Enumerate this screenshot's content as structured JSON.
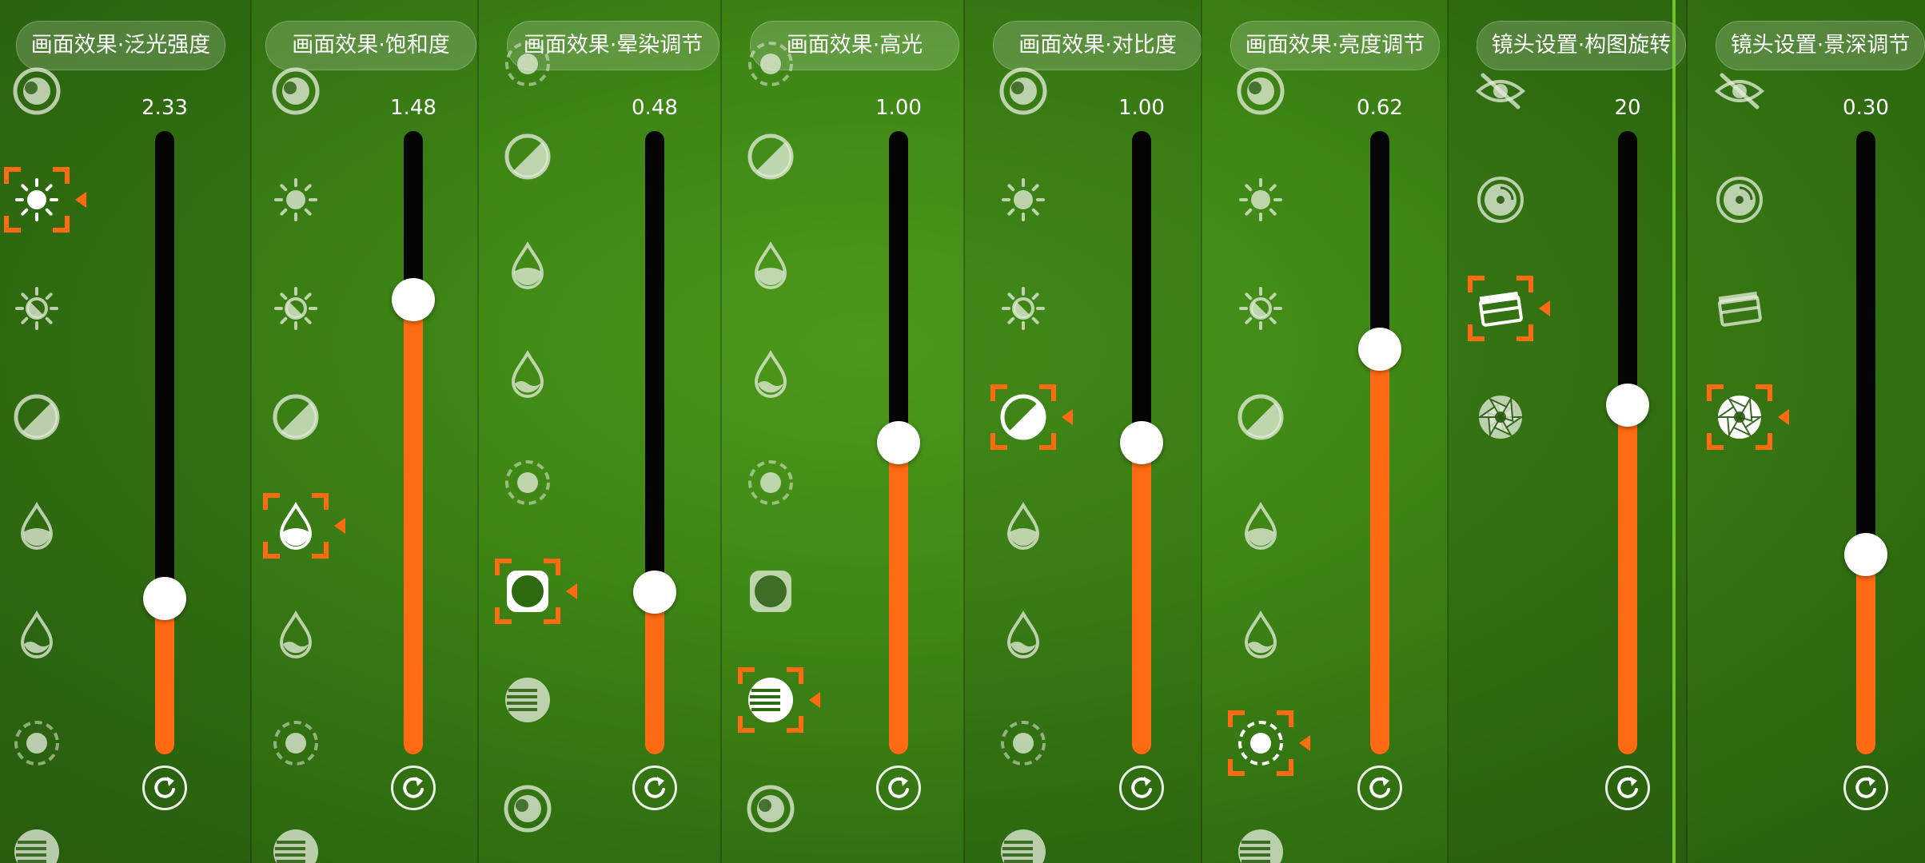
{
  "accent_color": "#ff6a13",
  "track_color": "#050505",
  "panels": [
    {
      "title": "画面效果·泛光强度",
      "value_text": "2.33",
      "level": 0.25,
      "selected_icon": "sun-full-icon",
      "icons": [
        "lens-icon",
        "sun-full-icon",
        "sun-half-icon",
        "contrast-icon",
        "drop-half-icon",
        "drop-wave-icon",
        "sun-dashed-icon",
        "stripes-icon"
      ],
      "reset_icon": "reset-icon"
    },
    {
      "title": "画面效果·饱和度",
      "value_text": "1.48",
      "level": 0.73,
      "selected_icon": "drop-half-icon",
      "icons": [
        "lens-icon",
        "sun-full-icon",
        "sun-half-icon",
        "contrast-icon",
        "drop-half-icon",
        "drop-wave-icon",
        "sun-dashed-icon",
        "stripes-icon"
      ],
      "reset_icon": "reset-icon"
    },
    {
      "title": "画面效果·晕染调节",
      "value_text": "0.48",
      "level": 0.26,
      "selected_icon": "vignette-icon",
      "icons": [
        "sun-dashed-icon",
        "contrast-icon",
        "drop-half-icon",
        "drop-wave-icon",
        "sun-dashed-icon",
        "vignette-icon",
        "stripes-icon",
        "lens-icon"
      ],
      "reset_icon": "reset-icon"
    },
    {
      "title": "画面效果·高光",
      "value_text": "1.00",
      "level": 0.5,
      "selected_icon": "stripes-icon",
      "icons": [
        "sun-dashed-icon",
        "contrast-icon",
        "drop-half-icon",
        "drop-wave-icon",
        "sun-dashed-icon",
        "vignette-icon",
        "stripes-icon",
        "lens-icon"
      ],
      "reset_icon": "reset-icon"
    },
    {
      "title": "画面效果·对比度",
      "value_text": "1.00",
      "level": 0.5,
      "selected_icon": "contrast-icon",
      "icons": [
        "lens-icon",
        "sun-full-icon",
        "sun-half-icon",
        "contrast-icon",
        "drop-half-icon",
        "drop-wave-icon",
        "sun-dashed-icon",
        "stripes-icon"
      ],
      "reset_icon": "reset-icon"
    },
    {
      "title": "画面效果·亮度调节",
      "value_text": "0.62",
      "level": 0.65,
      "selected_icon": "sun-dashed-icon",
      "icons": [
        "lens-icon",
        "sun-full-icon",
        "sun-half-icon",
        "contrast-icon",
        "drop-half-icon",
        "drop-wave-icon",
        "sun-dashed-icon",
        "stripes-icon"
      ],
      "reset_icon": "reset-icon"
    },
    {
      "title": "镜头设置·构图旋转",
      "value_text": "20",
      "level": 0.56,
      "selected_icon": "clapper-icon",
      "icons": [
        "eye-off-icon",
        "disc-icon",
        "clapper-icon",
        "aperture-icon"
      ],
      "reset_icon": "reset-icon"
    },
    {
      "title": "镜头设置·景深调节",
      "value_text": "0.30",
      "level": 0.32,
      "selected_icon": "aperture-icon",
      "icons": [
        "eye-off-icon",
        "disc-icon",
        "clapper-icon",
        "aperture-icon"
      ],
      "reset_icon": "reset-icon"
    }
  ]
}
